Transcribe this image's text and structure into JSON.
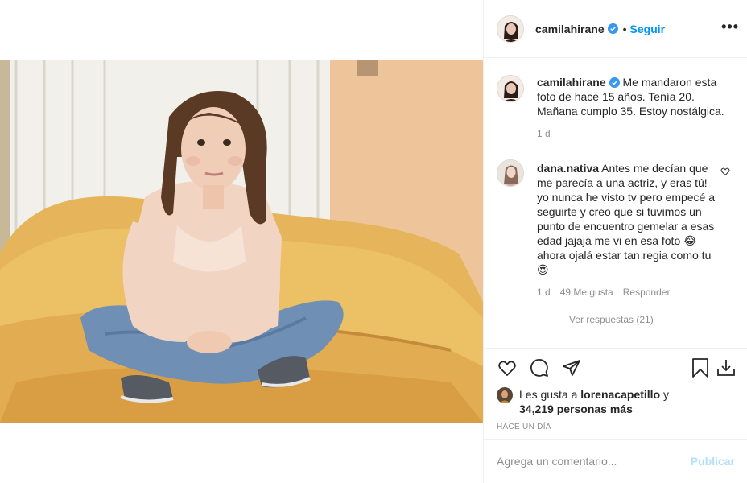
{
  "post": {
    "username": "camilahirane",
    "follow_label": "Seguir",
    "separator": "•",
    "more_label": "•••",
    "photo_alt": "Foto de una chica sentada en un sillón"
  },
  "caption": {
    "username": "camilahirane",
    "text": "Me mandaron esta foto de hace 15 años. Tenía 20. Mañana cumplo 35. Estoy nostálgica.",
    "time": "1 d"
  },
  "comments": [
    {
      "username": "dana.nativa",
      "text_part1": "Antes me decían que me parecía a una actriz, y eras tú! yo nunca he visto tv pero empecé a seguirte y creo que si tuvimos un punto de encuentro gemelar a esas edad jajaja me vi en esa foto ",
      "emoji1": "😂",
      "text_part2": " ahora ojalá estar tan regia como tu ",
      "emoji2": "😍",
      "time": "1 d",
      "likes": "49 Me gusta",
      "reply_label": "Responder",
      "view_replies": "Ver respuestas (21)"
    }
  ],
  "likes": {
    "prefix": "Les gusta a ",
    "user": "lorenacapetillo",
    "middle": " y",
    "count": "34,219 personas más"
  },
  "time_ago": "HACE UN DÍA",
  "add_comment": {
    "placeholder": "Agrega un comentario...",
    "publish_label": "Publicar"
  },
  "colors": {
    "accent": "#0095f6",
    "publish_disabled": "#b2dffc",
    "muted": "#8e8e8e"
  }
}
